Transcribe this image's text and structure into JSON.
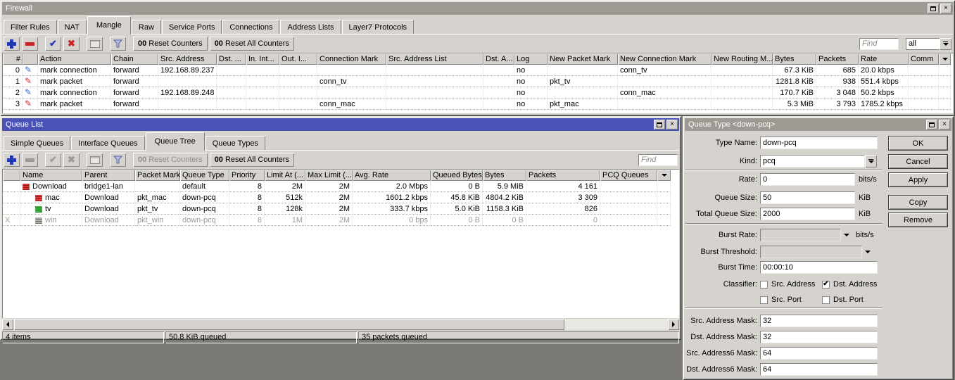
{
  "firewall": {
    "title": "Firewall",
    "tabs": [
      "Filter Rules",
      "NAT",
      "Mangle",
      "Raw",
      "Service Ports",
      "Connections",
      "Address Lists",
      "Layer7 Protocols"
    ],
    "active_tab": "Mangle",
    "toolbar": {
      "badge": "00",
      "reset_counters": "Reset Counters",
      "reset_all": "Reset All Counters",
      "find_placeholder": "Find",
      "view_filter": "all"
    },
    "columns": [
      "#",
      "",
      "Action",
      "Chain",
      "Src. Address",
      "Dst. ...",
      "In. Int...",
      "Out. I...",
      "Connection Mark",
      "Src. Address List",
      "Dst. A...",
      "Log",
      "New Packet Mark",
      "New Connection Mark",
      "New Routing M...",
      "Bytes",
      "Packets",
      "Rate",
      "Comm"
    ],
    "rows": [
      {
        "num": "0",
        "action": "mark connection",
        "chain": "forward",
        "src_address": "192.168.89.237",
        "dst_address": "",
        "in_if": "",
        "out_if": "",
        "connection_mark": "",
        "src_list": "",
        "dst_a": "",
        "log": "no",
        "new_packet_mark": "",
        "new_connection_mark": "conn_tv",
        "new_routing": "",
        "bytes": "67.3 KiB",
        "packets": "685",
        "rate": "20.0 kbps",
        "comment": ""
      },
      {
        "num": "1",
        "action": "mark packet",
        "chain": "forward",
        "src_address": "",
        "dst_address": "",
        "in_if": "",
        "out_if": "",
        "connection_mark": "conn_tv",
        "src_list": "",
        "dst_a": "",
        "log": "no",
        "new_packet_mark": "pkt_tv",
        "new_connection_mark": "",
        "new_routing": "",
        "bytes": "1281.8 KiB",
        "packets": "938",
        "rate": "551.4 kbps",
        "comment": ""
      },
      {
        "num": "2",
        "action": "mark connection",
        "chain": "forward",
        "src_address": "192.168.89.248",
        "dst_address": "",
        "in_if": "",
        "out_if": "",
        "connection_mark": "",
        "src_list": "",
        "dst_a": "",
        "log": "no",
        "new_packet_mark": "",
        "new_connection_mark": "conn_mac",
        "new_routing": "",
        "bytes": "170.7 KiB",
        "packets": "3 048",
        "rate": "50.2 kbps",
        "comment": ""
      },
      {
        "num": "3",
        "action": "mark packet",
        "chain": "forward",
        "src_address": "",
        "dst_address": "",
        "in_if": "",
        "out_if": "",
        "connection_mark": "conn_mac",
        "src_list": "",
        "dst_a": "",
        "log": "no",
        "new_packet_mark": "pkt_mac",
        "new_connection_mark": "",
        "new_routing": "",
        "bytes": "5.3 MiB",
        "packets": "3 793",
        "rate": "1785.2 kbps",
        "comment": ""
      }
    ]
  },
  "queue_list": {
    "title": "Queue List",
    "tabs": [
      "Simple Queues",
      "Interface Queues",
      "Queue Tree",
      "Queue Types"
    ],
    "active_tab": "Queue Tree",
    "toolbar": {
      "badge": "00",
      "reset_counters": "Reset Counters",
      "reset_all": "Reset All Counters",
      "find_placeholder": "Find"
    },
    "columns": [
      "",
      "Name",
      "Parent",
      "Packet Marks",
      "Queue Type",
      "Priority",
      "Limit At (...",
      "Max Limit (...",
      "Avg. Rate",
      "Queued Bytes",
      "Bytes",
      "Packets",
      "PCQ Queues"
    ],
    "rows": [
      {
        "flag": "",
        "name": "Download",
        "parent": "bridge1-lan",
        "packet_marks": "",
        "queue_type": "default",
        "priority": "8",
        "limit_at": "2M",
        "max_limit": "2M",
        "avg_rate": "2.0 Mbps",
        "queued_bytes": "0 B",
        "bytes": "5.9 MiB",
        "packets": "4 161",
        "pcq": ""
      },
      {
        "flag": "",
        "name": "mac",
        "parent": "Download",
        "packet_marks": "pkt_mac",
        "queue_type": "down-pcq",
        "priority": "8",
        "limit_at": "512k",
        "max_limit": "2M",
        "avg_rate": "1601.2 kbps",
        "queued_bytes": "45.8 KiB",
        "bytes": "4804.2 KiB",
        "packets": "3 309",
        "pcq": ""
      },
      {
        "flag": "",
        "name": "tv",
        "parent": "Download",
        "packet_marks": "pkt_tv",
        "queue_type": "down-pcq",
        "priority": "8",
        "limit_at": "128k",
        "max_limit": "2M",
        "avg_rate": "333.7 kbps",
        "queued_bytes": "5.0 KiB",
        "bytes": "1158.3 KiB",
        "packets": "826",
        "pcq": ""
      },
      {
        "flag": "X",
        "name": "win",
        "parent": "Download",
        "packet_marks": "pkt_win",
        "queue_type": "down-pcq",
        "priority": "8",
        "limit_at": "1M",
        "max_limit": "2M",
        "avg_rate": "0 bps",
        "queued_bytes": "0 B",
        "bytes": "0 B",
        "packets": "0",
        "pcq": ""
      }
    ],
    "status": [
      "4 items",
      "50.8 KiB queued",
      "35 packets queued"
    ]
  },
  "dialog": {
    "title": "Queue Type <down-pcq>",
    "fields": {
      "type_name_label": "Type Name:",
      "type_name": "down-pcq",
      "kind_label": "Kind:",
      "kind": "pcq",
      "rate_label": "Rate:",
      "rate": "0",
      "rate_unit": "bits/s",
      "queue_size_label": "Queue Size:",
      "queue_size": "50",
      "queue_size_unit": "KiB",
      "total_queue_size_label": "Total Queue Size:",
      "total_queue_size": "2000",
      "total_queue_size_unit": "KiB",
      "burst_rate_label": "Burst Rate:",
      "burst_rate": "",
      "burst_rate_unit": "bits/s",
      "burst_threshold_label": "Burst Threshold:",
      "burst_threshold": "",
      "burst_time_label": "Burst Time:",
      "burst_time": "00:00:10",
      "classifier_label": "Classifier:",
      "src_mask_label": "Src. Address Mask:",
      "src_mask": "32",
      "dst_mask_label": "Dst. Address Mask:",
      "dst_mask": "32",
      "src6_mask_label": "Src. Address6 Mask:",
      "src6_mask": "64",
      "dst6_mask_label": "Dst. Address6 Mask:",
      "dst6_mask": "64"
    },
    "classifiers": [
      {
        "label": "Src. Address",
        "mark": ""
      },
      {
        "label": "Dst. Address",
        "mark": "✔"
      },
      {
        "label": "Src. Port",
        "mark": ""
      },
      {
        "label": "Dst. Port",
        "mark": ""
      }
    ],
    "buttons": [
      "OK",
      "Cancel",
      "Apply",
      "Copy",
      "Remove"
    ]
  },
  "colors": {
    "title_active": "#4a52b5",
    "title_inactive": "#9c9a93",
    "window_bg": "#d6d3ce",
    "desktop_bg": "#7b7a74",
    "accent_blue": "#2038b8",
    "accent_red": "#c82424",
    "queue_red": "#e03434",
    "queue_green": "#3cb43c",
    "queue_gray": "#b4b2ac"
  }
}
